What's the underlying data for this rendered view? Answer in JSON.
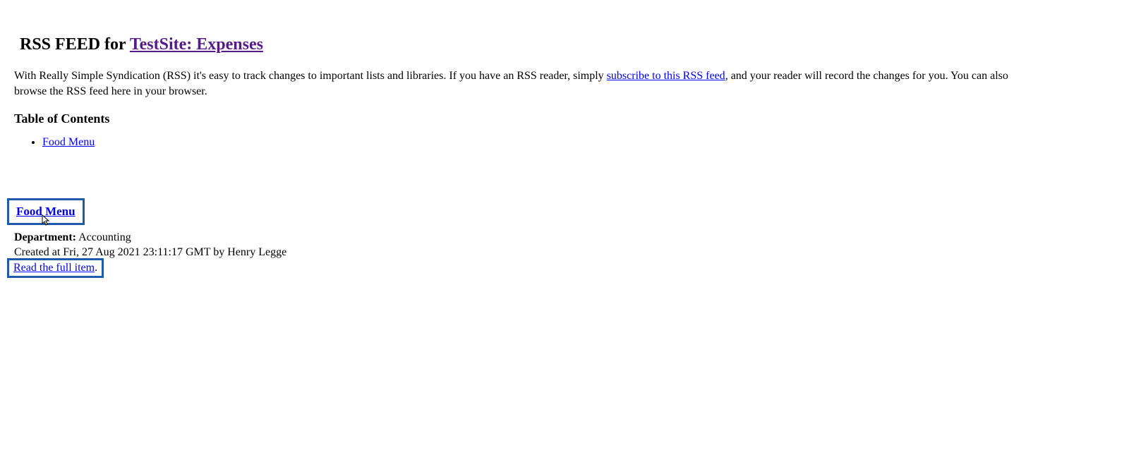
{
  "header": {
    "prefix": "RSS FEED for ",
    "site_link_text": "TestSite: Expenses"
  },
  "description": {
    "part1": "With Really Simple Syndication (RSS) it's easy to track changes to important lists and libraries. If you have an RSS reader, simply ",
    "subscribe_link": "subscribe to this RSS feed",
    "part2": ", and your reader will record the changes for you. You can also browse the RSS feed here in your browser."
  },
  "toc": {
    "heading": "Table of Contents",
    "items": [
      {
        "label": "Food Menu"
      }
    ]
  },
  "item": {
    "title": "Food Menu",
    "department_label": "Department:",
    "department_value": " Accounting",
    "created_text": "Created at Fri, 27 Aug 2021 23:11:17 GMT by Henry Legge",
    "read_full_label": "Read the full item",
    "trailing_period": "."
  }
}
